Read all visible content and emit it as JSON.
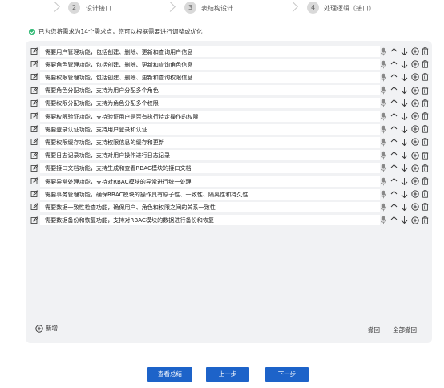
{
  "stepper": {
    "steps": [
      {
        "num": "2",
        "label": "设计接口"
      },
      {
        "num": "3",
        "label": "表结构设计"
      },
      {
        "num": "4",
        "label": "处理逻辑（接口）"
      }
    ]
  },
  "info": {
    "text": "已为您将需求为14个需求点，您可以根据需要进行调整或优化",
    "status_color": "#2eb872"
  },
  "requirements": [
    "需要用户管理功能，包括创建、删除、更新和查询用户信息",
    "需要角色管理功能，包括创建、删除、更新和查询角色信息",
    "需要权限管理功能，包括创建、删除、更新和查询权限信息",
    "需要角色分配功能，支持为用户分配多个角色",
    "需要权限分配功能，支持为角色分配多个权限",
    "需要权限验证功能，支持验证用户是否有执行特定操作的权限",
    "需要登录认证功能，支持用户登录和认证",
    "需要权限缓存功能，支持权限信息的缓存和更新",
    "需要日志记录功能，支持对用户操作进行日志记录",
    "需要接口文档功能，支持生成和查看RBAC模块的接口文档",
    "需要异常处理功能，支持对RBAC模块的异常进行统一处理",
    "需要事务管理功能，确保RBAC模块的操作具有原子性、一致性、隔离性和持久性",
    "需要数据一致性检查功能，确保用户、角色和权限之间的关系一致性",
    "需要数据备份和恢复功能，支持对RBAC模块的数据进行备份和恢复"
  ],
  "row_icons": [
    "edit-icon",
    "microphone-icon",
    "arrow-up-icon",
    "arrow-down-icon",
    "add-circle-icon",
    "trash-icon"
  ],
  "panel": {
    "add_label": "新增",
    "undo_label": "撤回",
    "undo_all_label": "全部撤回"
  },
  "buttons": {
    "view_summary": "查看总结",
    "prev": "上一步",
    "next": "下一步"
  },
  "colors": {
    "primary": "#1d63c9",
    "panel_bg": "#f1f2f4"
  }
}
